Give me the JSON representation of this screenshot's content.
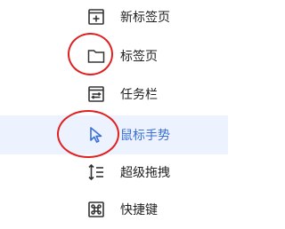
{
  "menu": {
    "items": [
      {
        "label": "新标签页",
        "icon": "new-tab-icon",
        "active": false
      },
      {
        "label": "标签页",
        "icon": "folder-icon",
        "active": false
      },
      {
        "label": "任务栏",
        "icon": "taskbar-icon",
        "active": false
      },
      {
        "label": "鼠标手势",
        "icon": "mouse-cursor-icon",
        "active": true
      },
      {
        "label": "超级拖拽",
        "icon": "drag-icon",
        "active": false
      },
      {
        "label": "快捷键",
        "icon": "command-key-icon",
        "active": false
      }
    ]
  },
  "colors": {
    "active_background": "#edf3fe",
    "active_text": "#3a6fd8",
    "annotation_circle": "#e02020"
  }
}
